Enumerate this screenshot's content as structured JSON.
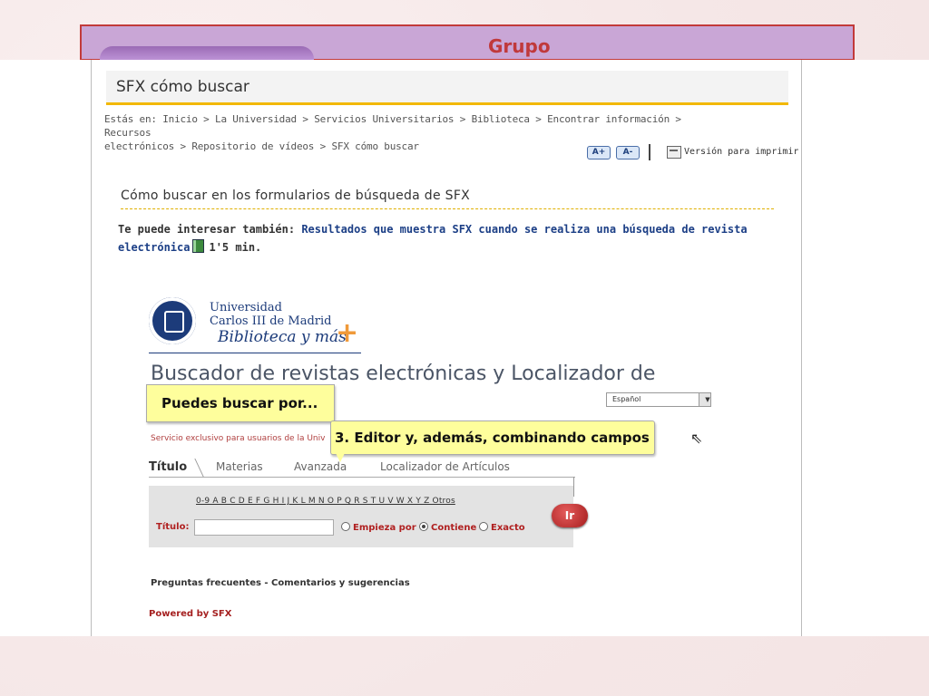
{
  "slide": {
    "header_title": "Grupo"
  },
  "page": {
    "title": "SFX cómo buscar",
    "breadcrumb_line1": "Estás en: Inicio > La Universidad > Servicios Universitarios > Biblioteca > Encontrar información > Recursos",
    "breadcrumb_line2": "electrónicos > Repositorio de vídeos > SFX cómo buscar",
    "font_increase": "A+",
    "font_decrease": "A-",
    "print_version": "Versión para imprimir",
    "section_title": "Cómo buscar en los formularios de búsqueda de SFX",
    "interest_label": "Te puede interesar también:",
    "interest_link_part1": "Resultados que muestra SFX cuando se realiza una búsqueda de revista",
    "interest_link_part2": "electrónica",
    "interest_duration": "1'5 min.",
    "icons": {
      "film": "film-icon",
      "print": "print-icon"
    }
  },
  "video": {
    "university_line1": "Universidad",
    "university_line2": "Carlos III de Madrid",
    "library_tagline": "Biblioteca y más",
    "plus_symbol": "+",
    "main_title": "Buscador de revistas electrónicas y Localizador de",
    "callout1": "Puedes buscar por...",
    "callout2": "3. Editor y, además, combinando campos",
    "language_select": "Español",
    "service_text": "Servicio exclusivo para usuarios de la Univ",
    "tabs": [
      "Título",
      "Materias",
      "Avanzada",
      "Localizador de Artículos"
    ],
    "letters": "0-9 A B C D E F G H I J K L M N O P Q R S T U V W X Y Z Otros",
    "title_label": "Título:",
    "radio_options": [
      "Empieza por",
      "Contiene",
      "Exacto"
    ],
    "selected_radio": "Contiene",
    "go_button": "Ir",
    "faq_links": "Preguntas frecuentes - Comentarios y sugerencias",
    "powered_by": "Powered by SFX"
  },
  "colors": {
    "accent": "#f2b800",
    "link": "#1c3f86",
    "brand_red": "#c0393b"
  }
}
